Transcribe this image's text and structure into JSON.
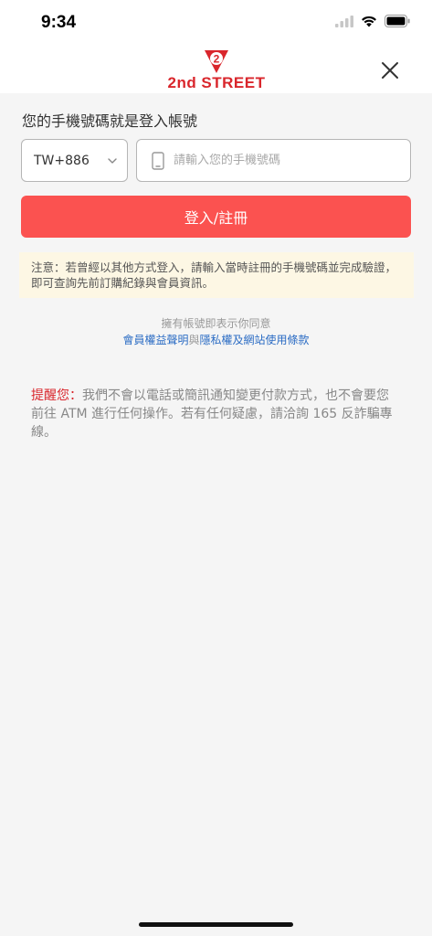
{
  "status_bar": {
    "time": "9:34"
  },
  "header": {
    "logo_text": "2nd STREET",
    "logo_mark": "2"
  },
  "login": {
    "title": "您的手機號碼就是登入帳號",
    "country_code": "TW+886",
    "phone_placeholder": "請輸入您的手機號碼",
    "submit_label": "登入/註冊"
  },
  "notice": {
    "text": "注意：若曾經以其他方式登入，請輸入當時註冊的手機號碼並完成驗證，即可查詢先前訂購紀錄與會員資訊。"
  },
  "agreement": {
    "prefix": "擁有帳號即表示你同意",
    "link1": "會員權益聲明",
    "joiner": "與",
    "link2": "隱私權及網站使用條款"
  },
  "warning": {
    "label": "提醒您：",
    "text": "我們不會以電話或簡訊通知變更付款方式，也不會要您前往 ATM 進行任何操作。若有任何疑慮，請洽詢 165 反詐騙專線。"
  },
  "colors": {
    "brand": "#d9262c",
    "button": "#fb5250",
    "link": "#2b6cc4",
    "notice_bg": "#fdf7e4"
  }
}
